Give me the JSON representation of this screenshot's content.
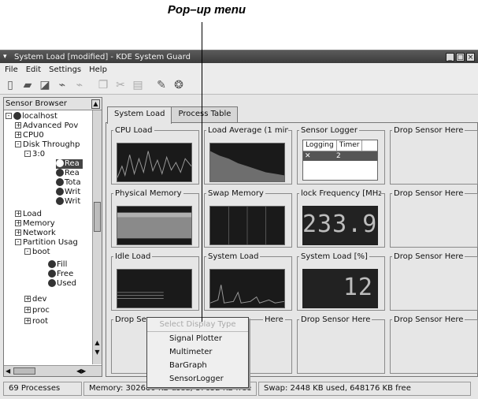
{
  "annotation": {
    "label": "Pop–up menu"
  },
  "window": {
    "title": "System Load [modified] - KDE System Guard"
  },
  "menubar": [
    "File",
    "Edit",
    "Settings",
    "Help"
  ],
  "sensor_browser": {
    "header": "Sensor Browser",
    "tree": [
      {
        "label": "localhost"
      },
      {
        "label": "Advanced Pov"
      },
      {
        "label": "CPU0"
      },
      {
        "label": "Disk Throughp"
      },
      {
        "label": "3:0"
      },
      {
        "label": "Rea"
      },
      {
        "label": "Rea"
      },
      {
        "label": "Tota"
      },
      {
        "label": "Writ"
      },
      {
        "label": "Writ"
      },
      {
        "label": "Load"
      },
      {
        "label": "Memory"
      },
      {
        "label": "Network"
      },
      {
        "label": "Partition Usag"
      },
      {
        "label": "boot"
      },
      {
        "label": "Fill"
      },
      {
        "label": "Free"
      },
      {
        "label": "Used"
      },
      {
        "label": "dev"
      },
      {
        "label": "proc"
      },
      {
        "label": "root"
      }
    ]
  },
  "tabs": [
    "System Load",
    "Process Table"
  ],
  "cells": [
    {
      "title": "CPU Load"
    },
    {
      "title": "Load Average (1 min"
    },
    {
      "title": "Sensor Logger"
    },
    {
      "title": "Drop Sensor Here"
    },
    {
      "title": "Physical Memory"
    },
    {
      "title": "Swap Memory"
    },
    {
      "title": "lock Frequency [MHz"
    },
    {
      "title": "Drop Sensor Here"
    },
    {
      "title": "Idle Load"
    },
    {
      "title": "System Load"
    },
    {
      "title": "System Load [%]"
    },
    {
      "title": "Drop Sensor Here"
    },
    {
      "title": "Drop Sen"
    },
    {
      "title": "Here"
    },
    {
      "title": "Drop Sensor Here"
    },
    {
      "title": "Drop Sensor Here"
    }
  ],
  "sensor_logger": {
    "col1": "Logging",
    "col2": "Timer",
    "row_val": "2"
  },
  "clock_value": "233.9",
  "system_load_value": "12",
  "popup": {
    "header": "Select Display Type",
    "items": [
      "Signal Plotter",
      "Multimeter",
      "BarGraph",
      "SensorLogger"
    ]
  },
  "status": {
    "processes": "69 Processes",
    "memory": "Memory: 302680 KB used, 17652 KB free",
    "swap": "Swap: 2448 KB used, 648176 KB free"
  },
  "colors": {
    "plot_bg": "#1a1a1a",
    "plot_line": "#9a9a9a",
    "selection": "#444444"
  }
}
